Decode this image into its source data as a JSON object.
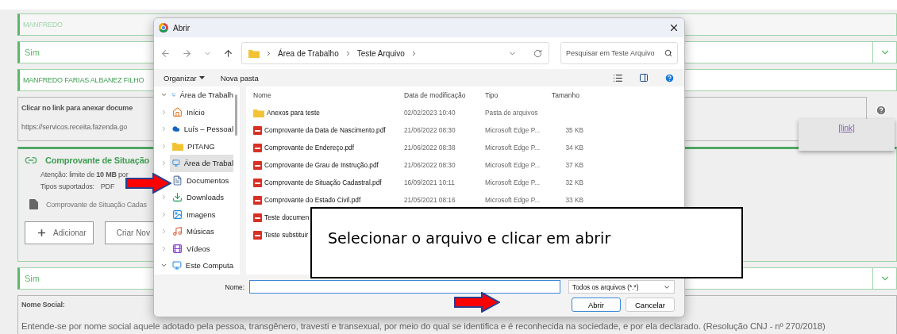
{
  "form": {
    "first_name": "MANFREDO",
    "select_1": "Sim",
    "full_name": "MANFREDO FARIAS ALBANEZ FILHO",
    "link_box": {
      "label": "Clicar no link para anexar docume",
      "url": "https://servicos.receita.fazenda.go"
    },
    "help_tooltip": {
      "link": "[link]"
    },
    "attachment": {
      "title": "Comprovante de Situação",
      "notice": "Atenção: limite de **10 MB** por",
      "types_label": "Tipos suportados:",
      "types": "PDF",
      "file": "Comprovante de Situação Cadas",
      "buttons": [
        "Adicionar",
        "Criar Nov"
      ]
    },
    "select_2": "Sim",
    "social_name": {
      "label": "Nome Social:",
      "description": "Entende-se por nome social aquele adotado pela pessoa, transgênero, travesti e transexual, por meio do qual se identifica e é reconhecida na sociedade, e por ela declarado. (Resolução CNJ - nº 270/2018)"
    }
  },
  "dialog": {
    "title": "Abrir",
    "breadcrumbs": [
      "Área de Trabalho",
      "Teste Arquivo"
    ],
    "search": {
      "placeholder": "Pesquisar em Teste Arquivo"
    },
    "toolbar": [
      "Organizar",
      "Nova pasta"
    ],
    "sidebar": [
      {
        "kind": "desktop",
        "label": "Área de Trabalh",
        "expanded": true,
        "selected": false
      },
      {
        "kind": "home",
        "label": "Início",
        "expanded": false,
        "selected": false
      },
      {
        "kind": "cloud",
        "label": "Luís – Pessoal",
        "expanded": false,
        "selected": false
      },
      {
        "kind": "folder",
        "label": "PITANG",
        "expanded": false,
        "selected": false
      },
      {
        "kind": "desktop",
        "label": "Área de Trabal",
        "expanded": false,
        "selected": true
      },
      {
        "kind": "documents",
        "label": "Documentos",
        "selected": false
      },
      {
        "kind": "downloads",
        "label": "Downloads",
        "expanded": false,
        "selected": false
      },
      {
        "kind": "pictures",
        "label": "Imagens",
        "expanded": false,
        "selected": false
      },
      {
        "kind": "music",
        "label": "Músicas",
        "expanded": false,
        "selected": false
      },
      {
        "kind": "videos",
        "label": "Vídeos",
        "expanded": false,
        "selected": false
      },
      {
        "kind": "computer",
        "label": "Este Computa",
        "expanded": true,
        "selected": false
      }
    ],
    "columns": [
      "Nome",
      "Data de modificação",
      "Tipo",
      "Tamanho"
    ],
    "files": [
      {
        "kind": "folder",
        "name": "Anexos para teste",
        "date": "02/02/2023 10:40",
        "type": "Pasta de arquivos"
      },
      {
        "kind": "pdf",
        "name": "Comprovante da Data de Nascimento.pdf",
        "date": "21/06/2022 08:30",
        "type": "Microsoft Edge P...",
        "size": "35 KB"
      },
      {
        "kind": "pdf",
        "name": "Comprovante de Endereço.pdf",
        "date": "21/06/2022 08:38",
        "type": "Microsoft Edge P...",
        "size": "34 KB"
      },
      {
        "kind": "pdf",
        "name": "Comprovante de Grau de Instrução.pdf",
        "date": "21/06/2022 08:30",
        "type": "Microsoft Edge P...",
        "size": "37 KB"
      },
      {
        "kind": "pdf",
        "name": "Comprovante de Situação Cadastral.pdf",
        "date": "16/09/2021 10:11",
        "type": "Microsoft Edge P...",
        "size": "32 KB"
      },
      {
        "kind": "pdf",
        "name": "Comprovante do Estado Civil.pdf",
        "date": "21/05/2021 08:16",
        "type": "Microsoft Edge P...",
        "size": "33 KB"
      },
      {
        "kind": "pdf",
        "name": "Teste documen"
      },
      {
        "kind": "pdf",
        "name": "Teste substituir"
      }
    ],
    "filename_label": "Nome:",
    "filter": "Todos os arquivos (*.*)",
    "buttons": [
      {
        "label": "Abrir",
        "default": true
      },
      {
        "label": "Cancelar",
        "default": false
      }
    ]
  },
  "callout": {
    "text": "Selecionar o arquivo e clicar em abrir"
  }
}
